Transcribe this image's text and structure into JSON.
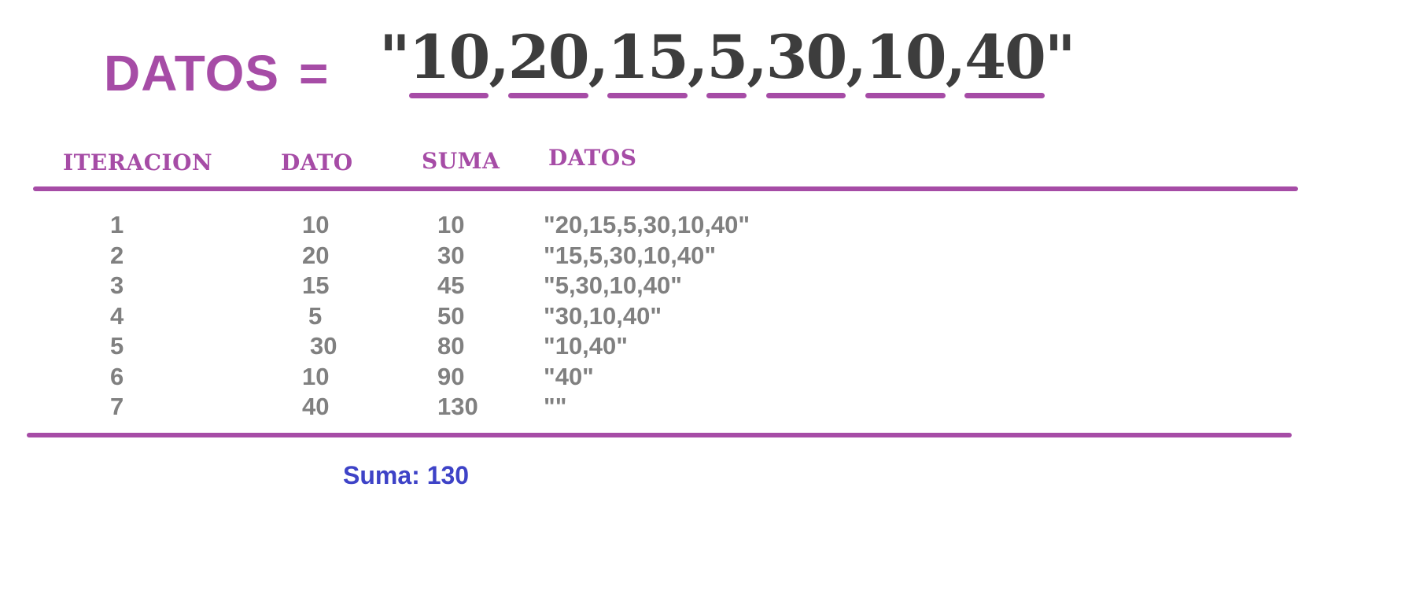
{
  "title": {
    "label": "DATOS",
    "equals": "=",
    "open_quote": "\"",
    "close_quote": "\"",
    "items": [
      "10",
      "20",
      "15",
      "5",
      "30",
      "10",
      "40"
    ],
    "separator": ","
  },
  "table": {
    "headers": [
      "ITERACION",
      "DATO",
      "SUMA",
      "DATOS"
    ],
    "rows": [
      {
        "iteracion": "1",
        "dato": "10",
        "suma": "10",
        "datos": "\"20,15,5,30,10,40\""
      },
      {
        "iteracion": "2",
        "dato": "20",
        "suma": "30",
        "datos": "\"15,5,30,10,40\""
      },
      {
        "iteracion": "3",
        "dato": "15",
        "suma": "45",
        "datos": "\"5,30,10,40\""
      },
      {
        "iteracion": "4",
        "dato": "5",
        "suma": "50",
        "datos": "\"30,10,40\""
      },
      {
        "iteracion": "5",
        "dato": "30",
        "suma": "80",
        "datos": "\"10,40\""
      },
      {
        "iteracion": "6",
        "dato": "10",
        "suma": "90",
        "datos": "\"40\""
      },
      {
        "iteracion": "7",
        "dato": "40",
        "suma": "130",
        "datos": "\"\""
      }
    ]
  },
  "result": "Suma: 130",
  "colors": {
    "accent": "#a64ca6",
    "string_text": "#3d3d3d",
    "table_text": "#808080",
    "result_text": "#3e43c7"
  }
}
